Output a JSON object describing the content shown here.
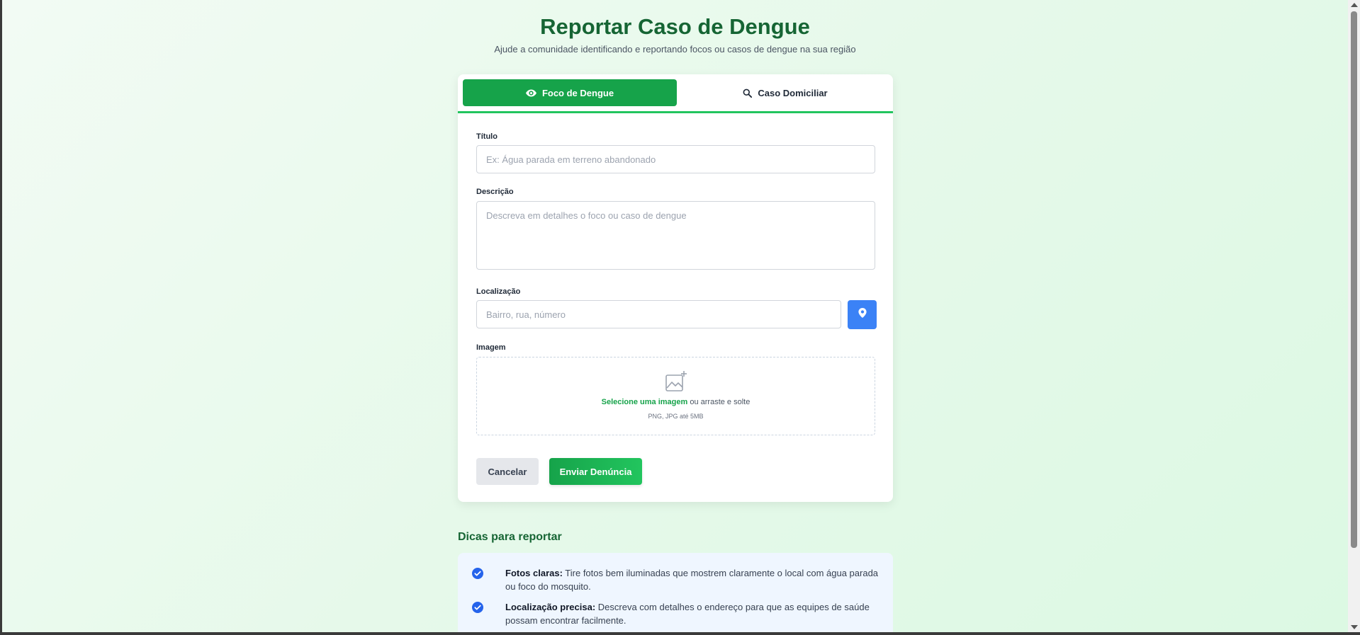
{
  "header": {
    "title": "Reportar Caso de Dengue",
    "subtitle": "Ajude a comunidade identificando e reportando focos ou casos de dengue na sua região"
  },
  "tabs": [
    {
      "label": "Foco de Dengue",
      "icon": "eye-icon",
      "active": true
    },
    {
      "label": "Caso Domiciliar",
      "icon": "search-icon",
      "active": false
    }
  ],
  "form": {
    "title_label": "Título",
    "title_placeholder": "Ex: Água parada em terreno abandonado",
    "description_label": "Descrição",
    "description_placeholder": "Descreva em detalhes o foco ou caso de dengue",
    "location_label": "Localização",
    "location_placeholder": "Bairro, rua, número",
    "location_button_icon": "map-pin-icon",
    "image_label": "Imagem",
    "image_select_link": "Selecione uma imagem",
    "image_drag_text": " ou arraste e solte",
    "image_hint": "PNG, JPG até 5MB",
    "cancel_label": "Cancelar",
    "submit_label": "Enviar Denúncia"
  },
  "tips": {
    "title": "Dicas para reportar",
    "items": [
      {
        "strong": "Fotos claras:",
        "text": " Tire fotos bem iluminadas que mostrem claramente o local com água parada ou foco do mosquito."
      },
      {
        "strong": "Localização precisa:",
        "text": " Descreva com detalhes o endereço para que as equipes de saúde possam encontrar facilmente."
      }
    ]
  },
  "colors": {
    "primary_green": "#16a34a",
    "title_green": "#166534",
    "location_blue": "#3b82f6",
    "tip_check_blue": "#2563eb"
  }
}
